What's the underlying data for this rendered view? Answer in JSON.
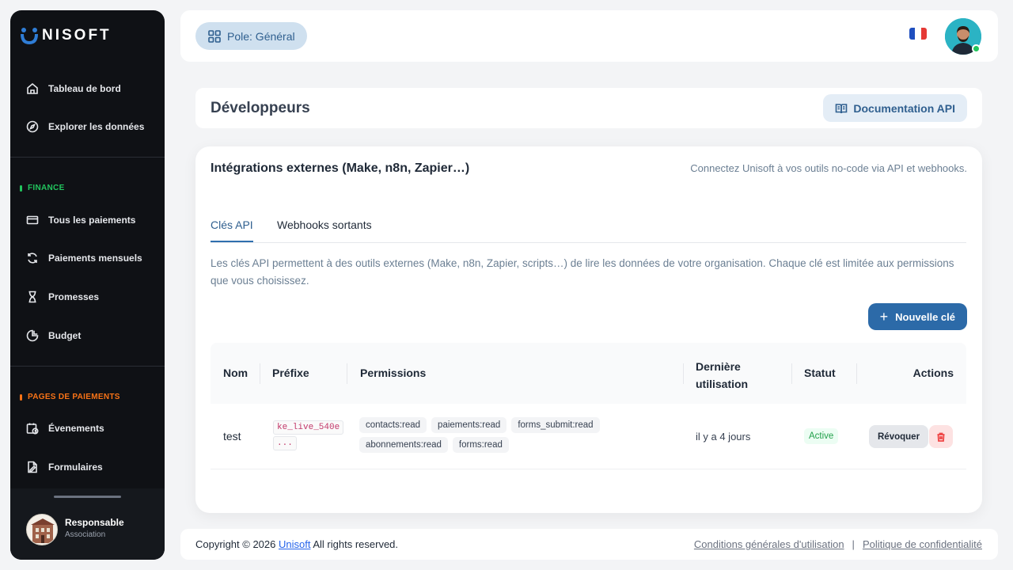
{
  "brand": {
    "name": "NISOFT"
  },
  "sidebar": {
    "top_items": [
      {
        "label": "Tableau de bord"
      },
      {
        "label": "Explorer les données"
      }
    ],
    "finance_label": "FINANCE",
    "finance_items": [
      {
        "label": "Tous les paiements"
      },
      {
        "label": "Paiements mensuels"
      },
      {
        "label": "Promesses"
      },
      {
        "label": "Budget"
      }
    ],
    "pages_label": "PAGES DE PAIEMENTS",
    "pages_items": [
      {
        "label": "Évenements"
      },
      {
        "label": "Formulaires"
      }
    ],
    "user": {
      "name": "Responsable",
      "role": "Association"
    }
  },
  "topbar": {
    "pole_label": "Pole: Général"
  },
  "developers": {
    "title": "Développeurs",
    "doc_button": "Documentation API"
  },
  "integrations": {
    "title": "Intégrations externes (Make, n8n, Zapier…)",
    "subtitle": "Connectez Unisoft à vos outils no-code via API et webhooks.",
    "tabs": [
      {
        "label": "Clés API"
      },
      {
        "label": "Webhooks sortants"
      }
    ],
    "description": "Les clés API permettent à des outils externes (Make, n8n, Zapier, scripts…) de lire les données de votre organisation. Chaque clé est limitée aux permissions que vous choisissez.",
    "new_key_button": "Nouvelle clé",
    "table": {
      "headers": {
        "name": "Nom",
        "prefix": "Préfixe",
        "permissions": "Permissions",
        "last_used": "Dernière utilisation",
        "status": "Statut",
        "actions": "Actions"
      },
      "rows": [
        {
          "name": "test",
          "prefix_line1": "ke_live_540e",
          "prefix_line2": "...",
          "permissions": [
            "contacts:read",
            "paiements:read",
            "forms_submit:read",
            "abonnements:read",
            "forms:read"
          ],
          "last_used": "il y a 4 jours",
          "status": "Active",
          "revoke_label": "Révoquer"
        }
      ]
    }
  },
  "footer": {
    "copyright_prefix": "Copyright © 2026",
    "company_link": "Unisoft",
    "copyright_suffix": "All rights reserved.",
    "terms": "Conditions générales d'utilisation",
    "separator": "|",
    "privacy": "Politique de confidentialité"
  },
  "colors": {
    "sidebar_bg": "#0f1115",
    "accent": "#2c6aa8",
    "finance": "#22c55e",
    "pages": "#f97316"
  }
}
